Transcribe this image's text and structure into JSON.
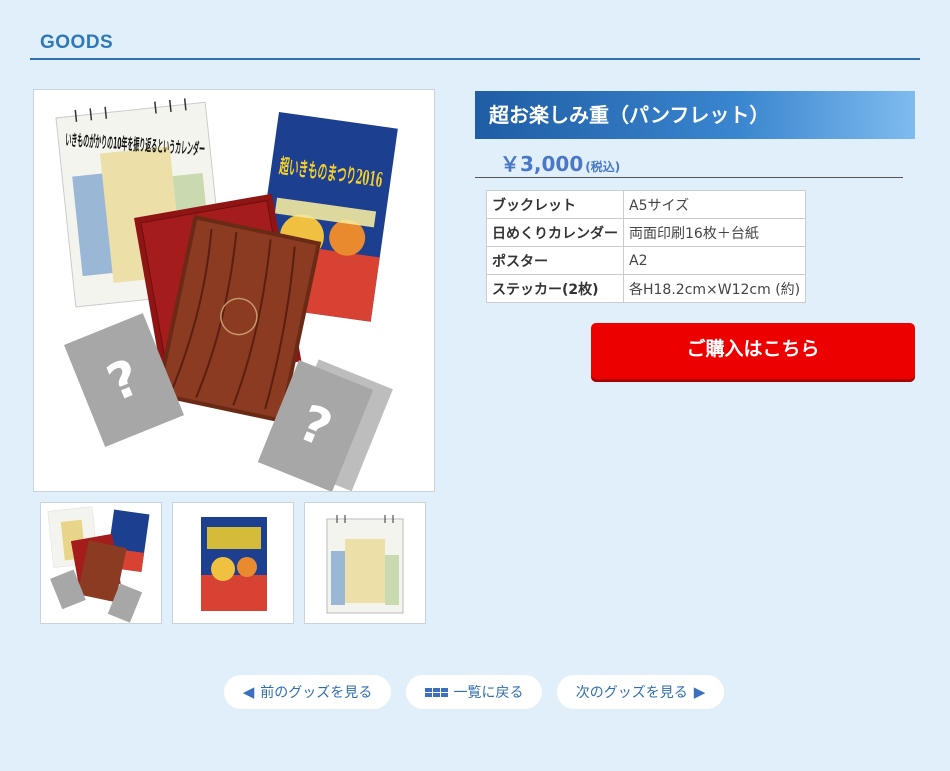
{
  "section": {
    "title": "GOODS"
  },
  "product": {
    "name": "超お楽しみ重（パンフレット）",
    "price": "￥3,000",
    "tax_note": "(税込)",
    "specs": [
      {
        "label": "ブックレット",
        "value": "A5サイズ"
      },
      {
        "label": "日めくりカレンダー",
        "value": "両面印刷16枚＋台紙"
      },
      {
        "label": "ポスター",
        "value": "A2"
      },
      {
        "label": "ステッカー(2枚)",
        "value": "各H18.2cm×W12cm (約)"
      }
    ],
    "buy_label": "ご購入はこちら",
    "artwork": {
      "calendar_text": "いきものがかりの10年を振り返るというカレンダー",
      "poster_text": "超いきものまつり2016",
      "sticker_glyph": "?"
    }
  },
  "colors": {
    "accent": "#2f78b8",
    "buy": "#ec0000",
    "price": "#4a78c4",
    "background": "#e0effa"
  },
  "nav": {
    "prev_label": "前のグッズを見る",
    "list_label": "一覧に戻る",
    "next_label": "次のグッズを見る",
    "prev_icon": "triangle-left-icon",
    "list_icon": "grid-list-icon",
    "next_icon": "triangle-right-icon"
  }
}
